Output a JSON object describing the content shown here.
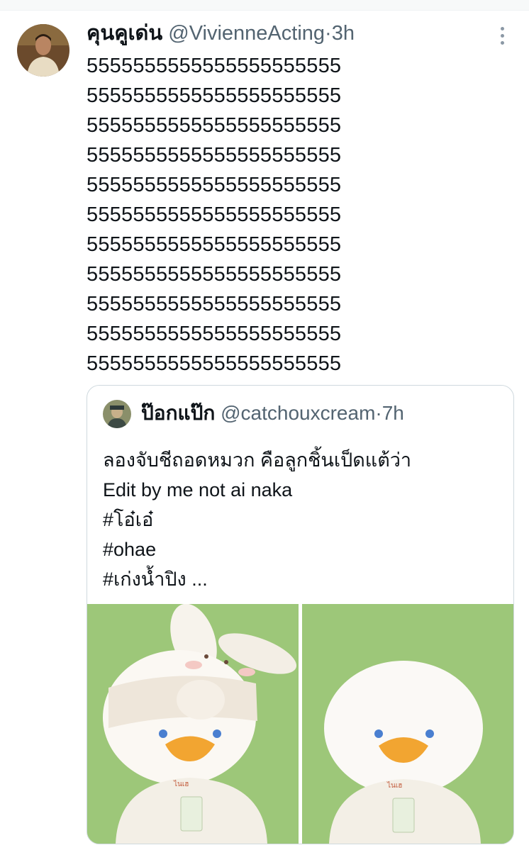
{
  "tweet": {
    "display_name": "คุนคูเด่น",
    "handle": "@VivienneActing",
    "separator": "·",
    "time": "3h",
    "body_lines": [
      "5555555555555555555555",
      "5555555555555555555555",
      "5555555555555555555555",
      "5555555555555555555555",
      "5555555555555555555555",
      "5555555555555555555555",
      "5555555555555555555555",
      "5555555555555555555555",
      "5555555555555555555555",
      "5555555555555555555555",
      "5555555555555555555555"
    ],
    "icons": {
      "avatar": "user-avatar",
      "more": "more-vertical-icon"
    }
  },
  "quote": {
    "display_name": "ป๊อกแป๊ก",
    "handle": "@catchouxcream",
    "separator": "·",
    "time": "7h",
    "text_lines": [
      "ลองจับชีถอดหมวก คือลูกชิ้นเป็ดแต้ว่า",
      "Edit by me not ai naka",
      "#โอ๋เอ๋",
      "#ohae",
      "#เก่งน้ำปิง ..."
    ],
    "media": [
      "duck-toy-with-bunny-hat-photo",
      "duck-toy-without-hat-photo"
    ]
  },
  "colors": {
    "text": "#0f1419",
    "secondary": "#536471",
    "border": "#cfd9de",
    "media_bg": "#9dc779"
  }
}
